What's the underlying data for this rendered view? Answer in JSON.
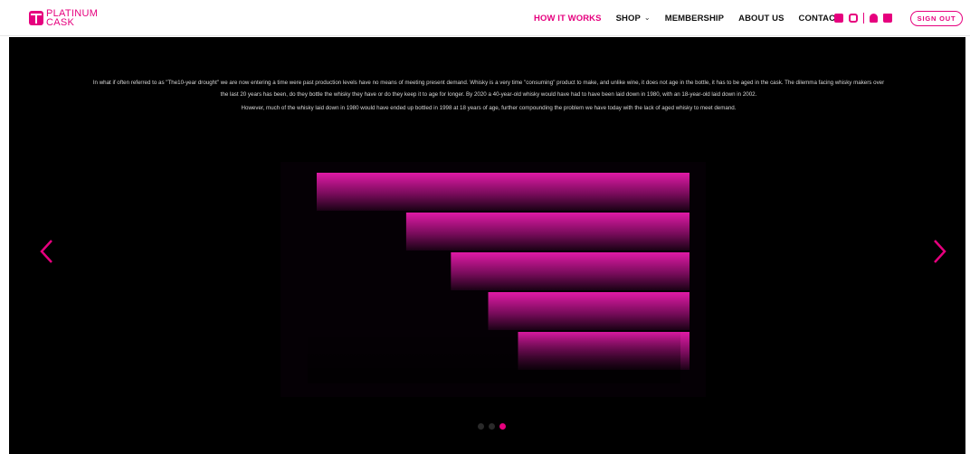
{
  "brand": {
    "line1": "PLATINUM",
    "line2": "CASK"
  },
  "nav": {
    "items": [
      {
        "label": "HOW IT WORKS",
        "active": true
      },
      {
        "label": "SHOP",
        "dropdown": true
      },
      {
        "label": "MEMBERSHIP"
      },
      {
        "label": "ABOUT US"
      },
      {
        "label": "CONTACT"
      }
    ],
    "chevron": "⌄"
  },
  "header_icons": [
    "facebook-icon",
    "instagram-icon",
    "user-icon",
    "shopping-bag-icon"
  ],
  "signout_label": "SIGN OUT",
  "slide": {
    "paragraph1": "In what if often referred to as \"The10-year drought\" we are now entering a time were past production levels have no means of meeting present demand. Whisky is a very time \"consuming\" product to make, and unlike wine, it does not age in the bottle, it has to be aged in the cask. The dilemma facing whisky makers over the last 20 years has been, do they bottle the whisky they have or do they keep it to age for longer. By 2020 a 40-year-old whisky would have had to have been laid down in 1980, with an 18-year-old laid down in 2002.",
    "paragraph2": "However, much of the whisky laid down in 1980 would have ended up bottled in 1998 at 18 years of age, further compounding the problem we have today with the lack of aged whisky to meet demand."
  },
  "carousel": {
    "slide_count": 3,
    "active_index": 2
  },
  "colors": {
    "accent": "#e6007e",
    "background": "#000000"
  },
  "chart_data": {
    "type": "bar",
    "orientation": "horizontal",
    "categories": [
      "",
      "",
      "",
      "",
      ""
    ],
    "values": [
      100,
      76,
      64,
      54,
      46
    ],
    "tick_labels": [
      "",
      "",
      "",
      "",
      ""
    ],
    "xlim": [
      0,
      100
    ],
    "grid": false
  }
}
